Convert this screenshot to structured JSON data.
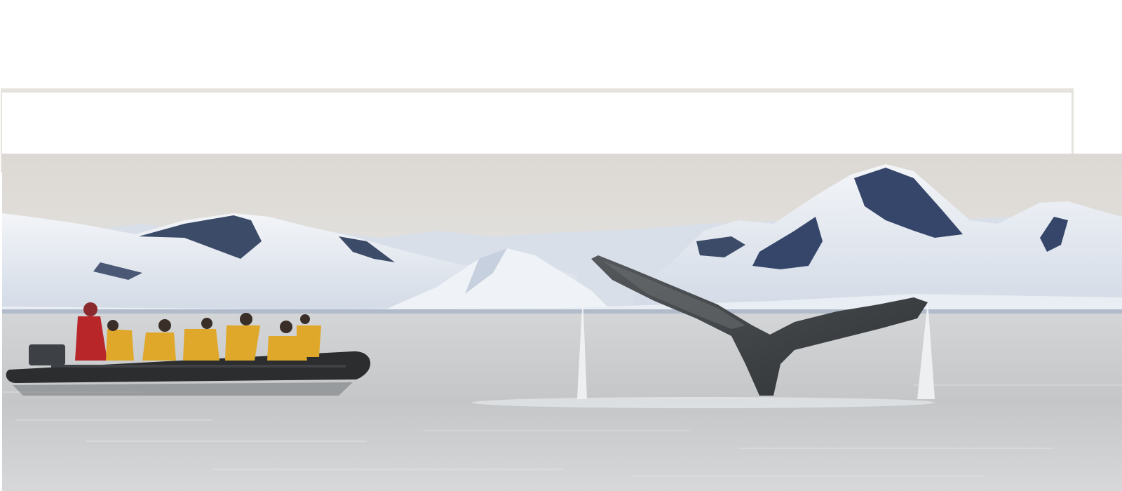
{
  "photo": {
    "alt_subject": "humpback-whale-tail-and-zodiac-boat",
    "colors": {
      "sky_top": "#ddd9d4",
      "sky_bottom": "#e3e2df",
      "snow": "#eef1f5",
      "snow_shadow": "#c9d3e0",
      "rock": "#3a4a68",
      "water": "#c9cbcc",
      "water_light": "#dcdedf",
      "boat": "#2b2d2f",
      "jacket_yellow": "#e0a82a",
      "jacket_red": "#b8262a",
      "whale_tail": "#3e4144"
    }
  }
}
